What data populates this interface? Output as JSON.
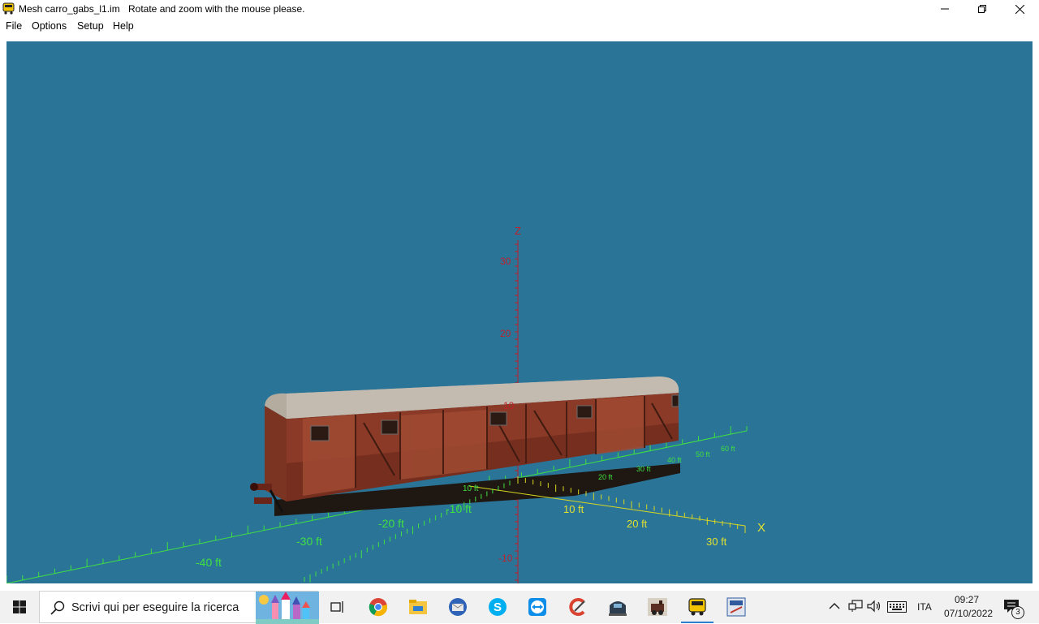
{
  "window": {
    "title": "Mesh carro_gabs_l1.im",
    "hint": "Rotate and zoom with the mouse please."
  },
  "menu": {
    "items": [
      "File",
      "Options",
      "Setup",
      "Help"
    ]
  },
  "viewport": {
    "background": "#2a7498",
    "z_axis": {
      "label": "Z",
      "ticks": [
        "30",
        "20",
        "10",
        "-10"
      ],
      "color": "#c0202a"
    },
    "x_axis": {
      "label": "X",
      "ticks_pos": [
        "10 ft",
        "20 ft",
        "30 ft"
      ],
      "ticks_neg": [
        "-10 ft",
        "-20 ft",
        "-30 ft",
        "-40 ft"
      ],
      "color": "#e0e030"
    },
    "y_axis": {
      "ticks": [
        "10 ft",
        "20 ft",
        "30 ft",
        "40 ft",
        "50 ft",
        "60 ft"
      ],
      "color": "#40e040"
    },
    "model": "boxcar-3d-model"
  },
  "taskbar": {
    "search_placeholder": "Scrivi qui per eseguire la ricerca",
    "language": "ITA",
    "time": "09:27",
    "date": "07/10/2022",
    "notification_count": "3",
    "icons": [
      "task-view-icon",
      "chrome-icon",
      "file-explorer-icon",
      "thunderbird-icon",
      "skype-icon",
      "teamviewer-icon",
      "ccleaner-icon",
      "train-sim-icon",
      "locomotive-app-icon",
      "mesh-viewer-app-icon",
      "shape-tool-icon"
    ]
  }
}
